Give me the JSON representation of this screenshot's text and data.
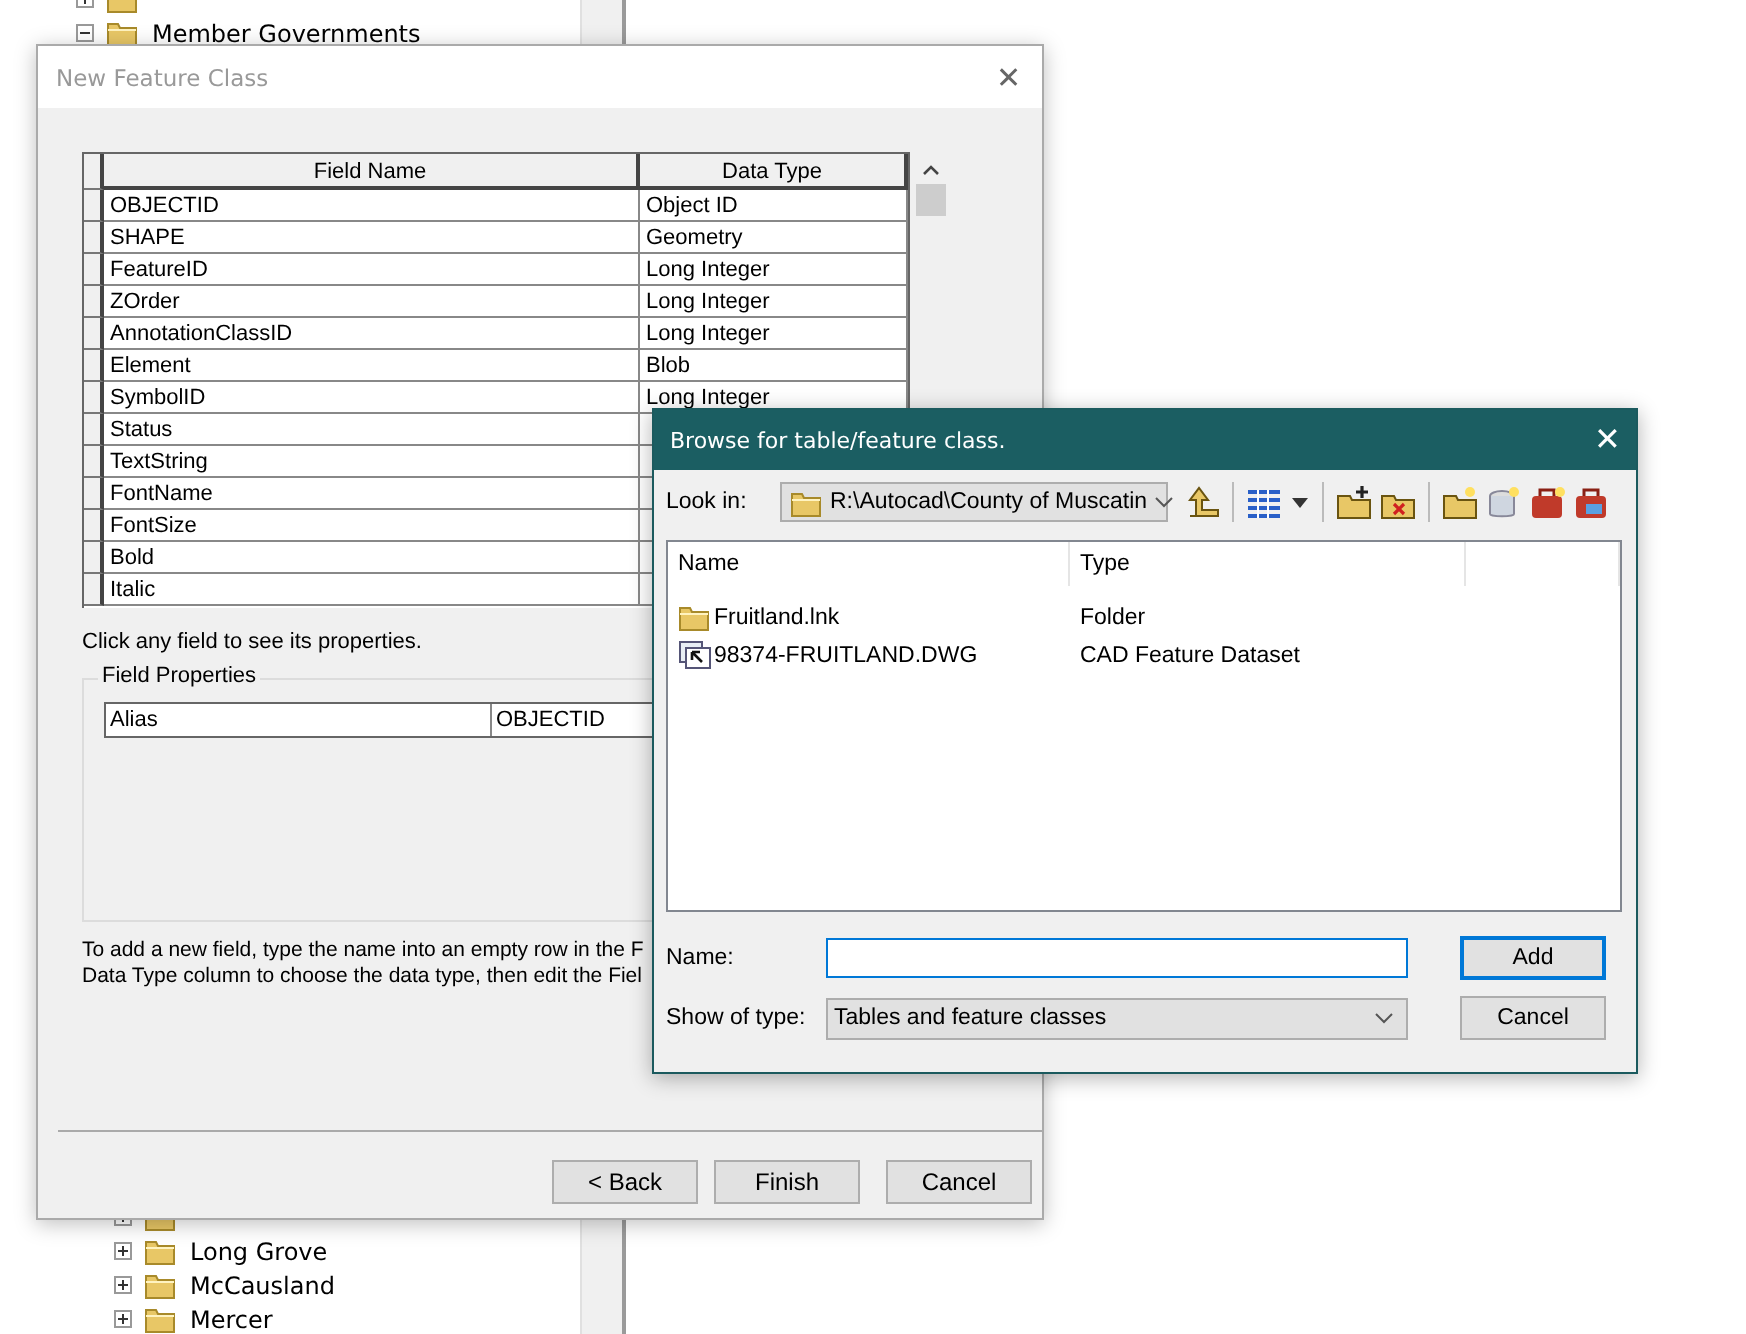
{
  "tree": {
    "items": [
      {
        "expanded": false
      },
      {
        "label": "Member Governments",
        "expanded": true
      }
    ],
    "bottom_items": [
      {
        "expanded": false
      },
      {
        "label": "Long Grove",
        "expanded": false
      },
      {
        "label": "McCausland",
        "expanded": false
      },
      {
        "label": "Mercer",
        "expanded": false
      }
    ]
  },
  "new_feature_class": {
    "title": "New Feature Class",
    "close": "✕",
    "table": {
      "columns": [
        "Field Name",
        "Data Type"
      ],
      "rows": [
        {
          "field_name": "OBJECTID",
          "data_type": "Object ID"
        },
        {
          "field_name": "SHAPE",
          "data_type": "Geometry"
        },
        {
          "field_name": "FeatureID",
          "data_type": "Long Integer"
        },
        {
          "field_name": "ZOrder",
          "data_type": "Long Integer"
        },
        {
          "field_name": "AnnotationClassID",
          "data_type": "Long Integer"
        },
        {
          "field_name": "Element",
          "data_type": "Blob"
        },
        {
          "field_name": "SymbolID",
          "data_type": "Long Integer"
        },
        {
          "field_name": "Status"
        },
        {
          "field_name": "TextString"
        },
        {
          "field_name": "FontName"
        },
        {
          "field_name": "FontSize"
        },
        {
          "field_name": "Bold"
        },
        {
          "field_name": "Italic"
        }
      ]
    },
    "hint": "Click any field to see its properties.",
    "field_properties": {
      "title": "Field Properties",
      "rows": [
        {
          "property": "Alias",
          "value": "OBJECTID"
        }
      ]
    },
    "instructions": [
      "To add a new field, type the name into an empty row in the F",
      "Data Type column to choose the data type, then edit the Fiel"
    ],
    "buttons": [
      "< Back",
      "Finish",
      "Cancel"
    ]
  },
  "browse_dialog": {
    "title": "Browse for table/feature class.",
    "close": "✕",
    "look_in_label": "Look in:",
    "look_in_value": "R:\\Autocad\\County of Muscatin",
    "list": {
      "columns": [
        "Name",
        "Type"
      ],
      "rows": [
        {
          "kind": "folder",
          "name": "Fruitland.lnk",
          "type": "Folder"
        },
        {
          "kind": "cad",
          "name": "98374-FRUITLAND.DWG",
          "type": "CAD Feature Dataset"
        }
      ]
    },
    "name_label": "Name:",
    "show_type_label": "Show of type:",
    "show_type_value": "Tables and feature classes",
    "buttons": [
      {
        "label": "Add",
        "default": true
      },
      {
        "label": "Cancel",
        "default": false
      }
    ]
  }
}
